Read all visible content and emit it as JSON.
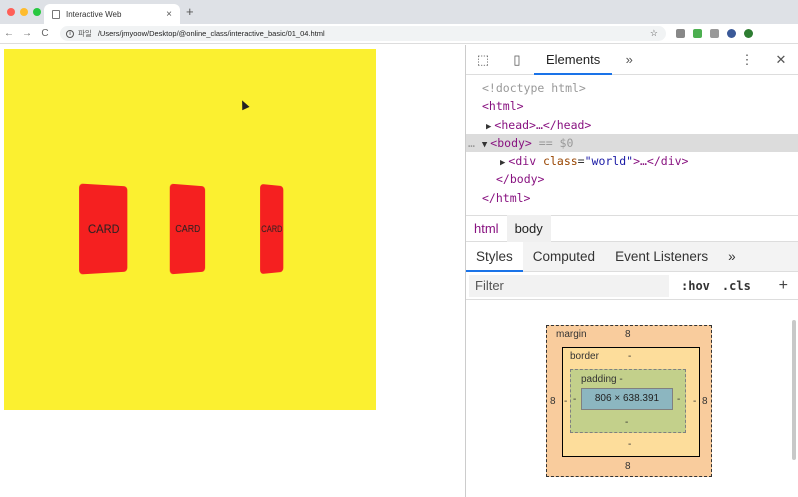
{
  "browser": {
    "tab_title": "Interactive Web",
    "tab_close": "×",
    "new_tab": "+",
    "url_scheme": "파일",
    "url": "/Users/jmyoow/Desktop/@online_class/interactive_basic/01_04.html",
    "info_icon": "i",
    "star": "☆",
    "back": "←",
    "forward": "→",
    "reload": "C",
    "traffic_light_colors": [
      "#ff5f57",
      "#febc2e",
      "#28c840"
    ]
  },
  "page": {
    "background": "#fbf030",
    "card_color": "#f52020",
    "cards": [
      "CARD",
      "CARD",
      "CARD"
    ]
  },
  "devtools": {
    "inspect_icon": "⬚",
    "device_icon": "▯",
    "tab_elements": "Elements",
    "more_tabs": "»",
    "menu": "⋮",
    "close": "✕",
    "dom": {
      "doctype": "<!doctype html>",
      "html_open": "<html>",
      "head": "<head>…</head>",
      "body_open": "<body>",
      "body_eq": " == $0",
      "div_tag": "<div ",
      "div_attr": "class",
      "div_eq": "=",
      "div_value": "\"world\"",
      "div_rest": ">…</div>",
      "body_close": "</body>",
      "html_close": "</html>",
      "dots": "…"
    },
    "breadcrumbs": [
      "html",
      "body"
    ],
    "subtabs": [
      "Styles",
      "Computed",
      "Event Listeners",
      "»"
    ],
    "filter_placeholder": "Filter",
    "hov": ":hov",
    "cls": ".cls",
    "plus": "+",
    "box_model": {
      "margin_label": "margin",
      "margin_top": "8",
      "margin_bottom": "8",
      "margin_left": "8",
      "margin_right": "8",
      "border_label": "border",
      "border_top": "-",
      "border_bottom": "-",
      "border_left": "-",
      "border_right": "-",
      "padding_label": "padding -",
      "padding_bottom": "-",
      "padding_left": "-",
      "padding_right": "-",
      "content": "806 × 638.391"
    }
  }
}
